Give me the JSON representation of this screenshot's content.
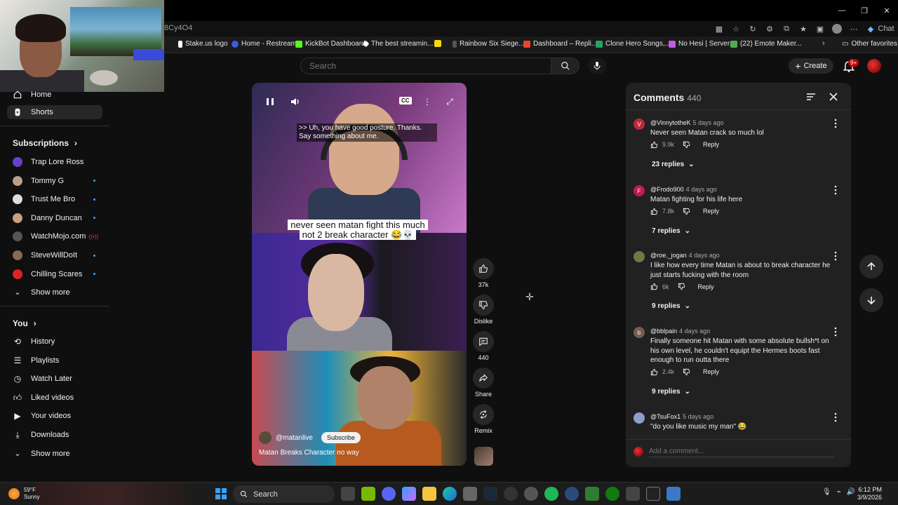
{
  "browser": {
    "address_text": "8Cy4O4",
    "chat_label": "Chat",
    "bookmarks": [
      {
        "label": "Stake.us logo",
        "color": "#ffffff"
      },
      {
        "label": "Home - Restream",
        "color": "#3b5bdb"
      },
      {
        "label": "KickBot Dashboard",
        "color": "#53fc18"
      },
      {
        "label": "The best streamin...",
        "color": "#ffffff"
      },
      {
        "label": "",
        "color": "#f5d90a"
      },
      {
        "label": "Rainbow Six Siege...",
        "color": "#dddddd"
      },
      {
        "label": "Dashboard – Repli...",
        "color": "#e8442e"
      },
      {
        "label": "Clone Hero Songs,...",
        "color": "#22a565"
      },
      {
        "label": "No Hesi | Servers",
        "color": "#c05ee0"
      },
      {
        "label": "(22) Emote Maker...",
        "color": "#4caf50"
      }
    ],
    "other_favorites": "Other favorites"
  },
  "youtube": {
    "search_placeholder": "Search",
    "create_label": "Create",
    "notif_badge": "9+"
  },
  "sidebar": {
    "home": "Home",
    "shorts": "Shorts",
    "subscriptions_heading": "Subscriptions",
    "subscriptions": [
      {
        "name": "Trap Lore Ross",
        "color": "#6a3fc9",
        "indicator": "none"
      },
      {
        "name": "Tommy G",
        "color": "#bba088",
        "indicator": "dot"
      },
      {
        "name": "Trust Me Bro",
        "color": "#dddddd",
        "indicator": "dot"
      },
      {
        "name": "Danny Duncan",
        "color": "#c8a080",
        "indicator": "dot"
      },
      {
        "name": "WatchMojo.com",
        "color": "#555555",
        "indicator": "live"
      },
      {
        "name": "SteveWillDoIt",
        "color": "#8a6a50",
        "indicator": "dot"
      },
      {
        "name": "Chilling Scares",
        "color": "#d22",
        "indicator": "dot"
      }
    ],
    "show_more_1": "Show more",
    "you_heading": "You",
    "you_items": [
      {
        "label": "History",
        "icon": "history-icon"
      },
      {
        "label": "Playlists",
        "icon": "playlists-icon"
      },
      {
        "label": "Watch Later",
        "icon": "watch-later-icon"
      },
      {
        "label": "Liked videos",
        "icon": "thumbs-up-icon"
      },
      {
        "label": "Your videos",
        "icon": "your-videos-icon"
      },
      {
        "label": "Downloads",
        "icon": "download-icon"
      }
    ],
    "show_more_2": "Show more"
  },
  "video": {
    "cc_label": "CC",
    "caption": ">> Uh, you have good posture. Thanks. Say something about me.",
    "overlay_line1": "never seen matan fight this much",
    "overlay_line2": "not 2  break character 😂💀",
    "channel": "@matanlive",
    "subscribe_label": "Subscribe",
    "title": "Matan Breaks Character no way"
  },
  "actions": {
    "likes": "37k",
    "dislike": "Dislike",
    "comments": "440",
    "share": "Share",
    "remix": "Remix"
  },
  "comments": {
    "title": "Comments",
    "count": "440",
    "add_placeholder": "Add a comment...",
    "reply_label": "Reply",
    "items": [
      {
        "author": "@VinnytotheK",
        "time": "5 days ago",
        "text": "Never seen Matan crack so much lol",
        "likes": "9.9k",
        "replies": "23 replies",
        "avatar_color": "#c0283a",
        "initial": "V"
      },
      {
        "author": "@Frodo900",
        "time": "4 days ago",
        "text": "Matan fighting for his life here",
        "likes": "7.8k",
        "replies": "7 replies",
        "avatar_color": "#c2185b",
        "initial": "F"
      },
      {
        "author": "@roe._jogan",
        "time": "4 days ago",
        "text": "I like how every time Matan is about to break character he just starts fucking with the room",
        "likes": "6k",
        "replies": "9 replies",
        "avatar_color": "#6a7a4a",
        "initial": ""
      },
      {
        "author": "@bblpain",
        "time": "4 days ago",
        "text": "Finally someone hit Matan with some absolute bullsh*t on his own level, he couldn't equipt the Hermes boots fast enough to run outta there",
        "likes": "2.4k",
        "replies": "9 replies",
        "avatar_color": "#7a5a55",
        "initial": "b"
      },
      {
        "author": "@TsuFox1",
        "time": "5 days ago",
        "text": "\"do you like music my man\" 😂",
        "likes": "",
        "replies": "",
        "avatar_color": "#8aa0c8",
        "initial": ""
      }
    ]
  },
  "taskbar": {
    "temp": "59°F",
    "condition": "Sunny",
    "search_label": "Search",
    "time": "6:12 PM",
    "date": "3/9/2026"
  }
}
